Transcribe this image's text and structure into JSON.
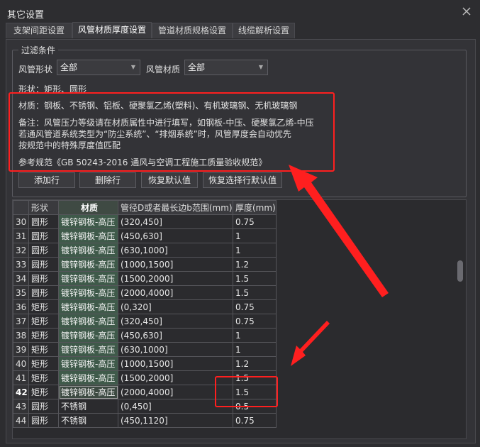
{
  "window": {
    "title": "其它设置"
  },
  "tabs": [
    {
      "label": "支架间距设置",
      "active": false
    },
    {
      "label": "风管材质厚度设置",
      "active": true
    },
    {
      "label": "管道材质规格设置",
      "active": false
    },
    {
      "label": "线缆解析设置",
      "active": false
    }
  ],
  "filter": {
    "title": "过滤条件",
    "shape_label": "风管形状",
    "shape_value": "全部",
    "material_label": "风管材质",
    "material_value": "全部",
    "shape_line": "形状：矩形、圆形",
    "material_line": "材质：钢板、不锈钢、铝板、硬聚氯乙烯(塑料)、有机玻璃钢、无机玻璃钢",
    "note_line1": "备注：风管压力等级请在材质属性中进行填写，如钢板-中压、硬聚氯乙烯-中压",
    "note_line2": "若通风管道系统类型为“防尘系统”、“排烟系统”时，风管厚度会自动优先",
    "note_line3": "按规范中的特殊厚度值匹配",
    "reference_line": "参考规范《GB 50243-2016 通风与空调工程施工质量验收规范》"
  },
  "buttons": {
    "add_row": "添加行",
    "delete_row": "删除行",
    "restore_default": "恢复默认值",
    "restore_selected_default": "恢复选择行默认值"
  },
  "table": {
    "headers": [
      "",
      "形状",
      "材质",
      "管径D或者最长边b范围(mm)",
      "厚度(mm)"
    ],
    "rows": [
      [
        "30",
        "圆形",
        "镀锌钢板-高压",
        "(320,450]",
        "0.75"
      ],
      [
        "31",
        "圆形",
        "镀锌钢板-高压",
        "(450,630]",
        "1"
      ],
      [
        "32",
        "圆形",
        "镀锌钢板-高压",
        "(630,1000]",
        "1"
      ],
      [
        "33",
        "圆形",
        "镀锌钢板-高压",
        "(1000,1500]",
        "1.2"
      ],
      [
        "34",
        "圆形",
        "镀锌钢板-高压",
        "(1500,2000]",
        "1.5"
      ],
      [
        "35",
        "圆形",
        "镀锌钢板-高压",
        "(2000,4000]",
        "1.5"
      ],
      [
        "36",
        "矩形",
        "镀锌钢板-高压",
        "(0,320]",
        "0.75"
      ],
      [
        "37",
        "矩形",
        "镀锌钢板-高压",
        "(320,450]",
        "0.75"
      ],
      [
        "38",
        "矩形",
        "镀锌钢板-高压",
        "(450,630]",
        "1"
      ],
      [
        "39",
        "矩形",
        "镀锌钢板-高压",
        "(630,1000]",
        "1"
      ],
      [
        "40",
        "矩形",
        "镀锌钢板-高压",
        "(1000,1500]",
        "1.2"
      ],
      [
        "41",
        "矩形",
        "镀锌钢板-高压",
        "(1500,2000]",
        "1.5"
      ],
      [
        "42",
        "矩形",
        "镀锌钢板-高压",
        "(2000,4000]",
        "1.5"
      ],
      [
        "43",
        "圆形",
        "不锈钢",
        "(0,450]",
        "0.5"
      ],
      [
        "44",
        "圆形",
        "不锈钢",
        "(450,1120]",
        "0.75"
      ]
    ],
    "current_row": "42"
  },
  "colors": {
    "annotation_red": "#ff1f1f",
    "material_cell_bg": "#3f5a4a",
    "background": "#2d2d30"
  }
}
